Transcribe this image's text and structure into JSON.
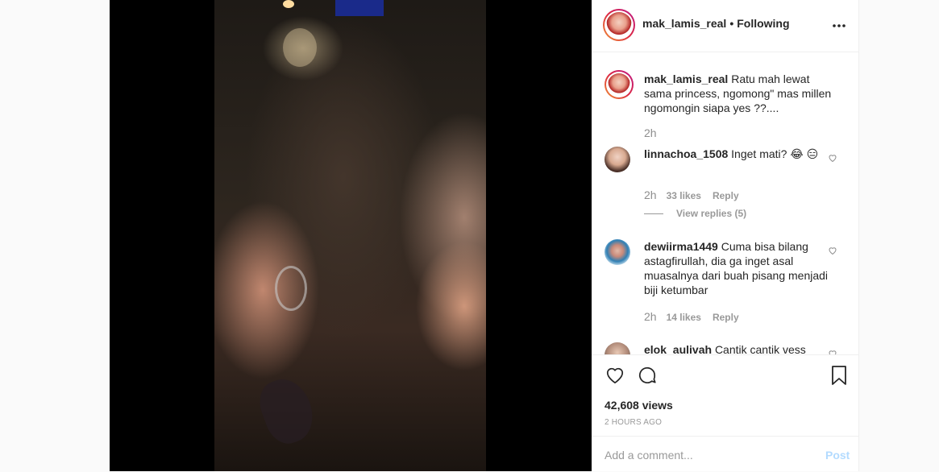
{
  "header": {
    "username": "mak_lamis_real",
    "separator": "•",
    "follow_state": "Following",
    "more_icon": "more-options-icon"
  },
  "caption": {
    "username": "mak_lamis_real",
    "text": "Ratu mah lewat sama princess, ngomong\" mas millen ngomongin siapa yes ??....",
    "time": "2h"
  },
  "comments": [
    {
      "username": "linnachoa_1508",
      "text": "Inget mati? 😂 😑",
      "time": "2h",
      "likes": "33 likes",
      "reply_label": "Reply",
      "view_replies": "View replies (5)"
    },
    {
      "username": "dewiirma1449",
      "text": "Cuma bisa bilang astagfirullah, dia ga inget asal muasalnya dari buah pisang menjadi biji ketumbar",
      "time": "2h",
      "likes": "14 likes",
      "reply_label": "Reply"
    },
    {
      "username": "elok_aulivah",
      "text": "Cantik cantik vess"
    }
  ],
  "actions": {
    "views": "42,608 views",
    "posted_ago": "2 HOURS AGO"
  },
  "add_comment": {
    "placeholder": "Add a comment...",
    "post_label": "Post"
  },
  "colors": {
    "text": "#262626",
    "muted": "#8e8e8e",
    "post_disabled": "#b3dbff",
    "story_ring": "#dc2743"
  }
}
